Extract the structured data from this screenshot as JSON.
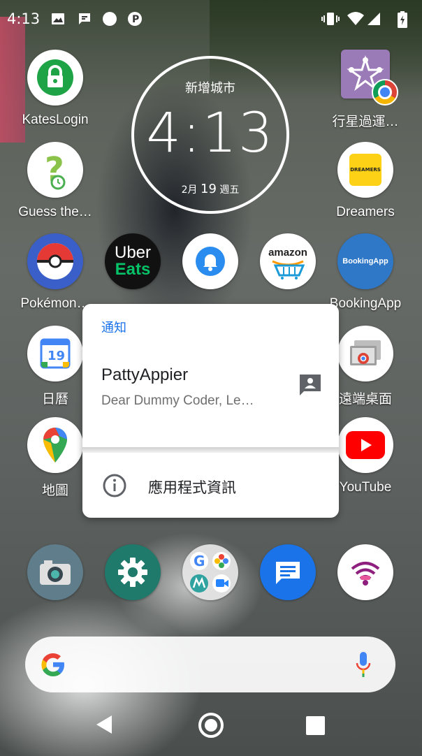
{
  "status_bar": {
    "time": "4:13",
    "icons": [
      "image-icon",
      "message-icon",
      "circle-icon",
      "p-icon",
      "vibrate-icon",
      "wifi-icon",
      "signal-icon",
      "battery-icon"
    ]
  },
  "clock_widget": {
    "city": "新增城市",
    "time": "4:13",
    "month": "2月",
    "day": "19",
    "weekday": "週五"
  },
  "apps": {
    "kateslogin": "KatesLogin",
    "planet_app": "行星過運…",
    "guess": "Guess the…",
    "dreamers": "Dreamers",
    "pokemon": "Pokémon…",
    "bookingapp": "BookingApp",
    "calendar": "日曆",
    "remote_desktop": "遠端桌面",
    "maps": "地圖",
    "youtube": "YouTube",
    "uber_icon_text_1": "Uber",
    "uber_icon_text_2": "Eats",
    "amazon_icon_text": "amazon",
    "bookingapp_icon_text": "BookingApp",
    "dreamers_icon_text": "DREAMERS"
  },
  "popup": {
    "header": "通知",
    "notification_title": "PattyAppier",
    "notification_body": "Dear Dummy Coder, Le…",
    "app_info_label": "應用程式資訊"
  },
  "dock": {
    "apps": [
      "camera-icon",
      "settings-icon",
      "google-folder-icon",
      "messages-icon",
      "wifi-app-icon"
    ]
  },
  "colors": {
    "accent_blue": "#1a73e8",
    "youtube_red": "#ff0000",
    "booking_blue": "#2e78c7",
    "settings_teal": "#1f7a6b"
  }
}
